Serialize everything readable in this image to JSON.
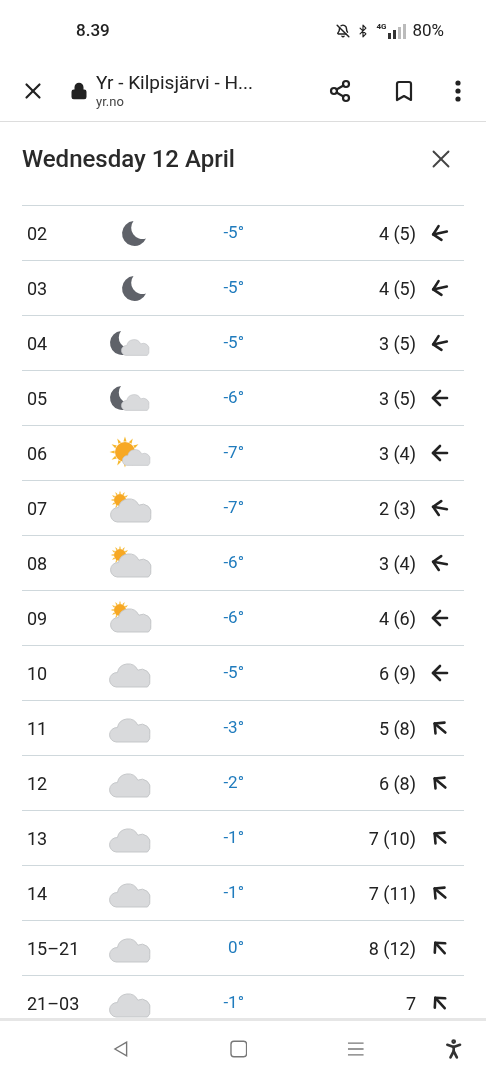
{
  "status_bar": {
    "time": "8.39",
    "network": "4G",
    "battery": "80%"
  },
  "browser_bar": {
    "title": "Yr - Kilpisjärvi - H...",
    "url": "yr.no"
  },
  "panel": {
    "title": "Wednesday 12 April"
  },
  "rows": [
    {
      "time": "02",
      "weather": {
        "kind": "moon"
      },
      "temperature": "-5°",
      "wind": "4 (5)",
      "wind_arrow": {
        "kind": "wsw"
      }
    },
    {
      "time": "03",
      "weather": {
        "kind": "moon"
      },
      "temperature": "-5°",
      "wind": "4 (5)",
      "wind_arrow": {
        "kind": "wsw"
      }
    },
    {
      "time": "04",
      "weather": {
        "kind": "moon_cloud"
      },
      "temperature": "-5°",
      "wind": "3 (5)",
      "wind_arrow": {
        "kind": "wsw"
      }
    },
    {
      "time": "05",
      "weather": {
        "kind": "moon_cloud"
      },
      "temperature": "-6°",
      "wind": "3 (5)",
      "wind_arrow": {
        "kind": "w"
      }
    },
    {
      "time": "06",
      "weather": {
        "kind": "sun_cloud"
      },
      "temperature": "-7°",
      "wind": "3 (4)",
      "wind_arrow": {
        "kind": "w"
      }
    },
    {
      "time": "07",
      "weather": {
        "kind": "cloud_sun"
      },
      "temperature": "-7°",
      "wind": "2 (3)",
      "wind_arrow": {
        "kind": "wnw"
      }
    },
    {
      "time": "08",
      "weather": {
        "kind": "cloud_sun"
      },
      "temperature": "-6°",
      "wind": "3 (4)",
      "wind_arrow": {
        "kind": "wnw"
      }
    },
    {
      "time": "09",
      "weather": {
        "kind": "cloud_sun"
      },
      "temperature": "-6°",
      "wind": "4 (6)",
      "wind_arrow": {
        "kind": "w"
      }
    },
    {
      "time": "10",
      "weather": {
        "kind": "cloud"
      },
      "temperature": "-5°",
      "wind": "6 (9)",
      "wind_arrow": {
        "kind": "w"
      }
    },
    {
      "time": "11",
      "weather": {
        "kind": "cloud"
      },
      "temperature": "-3°",
      "wind": "5 (8)",
      "wind_arrow": {
        "kind": "nw"
      }
    },
    {
      "time": "12",
      "weather": {
        "kind": "cloud"
      },
      "temperature": "-2°",
      "wind": "6 (8)",
      "wind_arrow": {
        "kind": "nw"
      }
    },
    {
      "time": "13",
      "weather": {
        "kind": "cloud"
      },
      "temperature": "-1°",
      "wind": "7 (10)",
      "wind_arrow": {
        "kind": "nw"
      }
    },
    {
      "time": "14",
      "weather": {
        "kind": "cloud"
      },
      "temperature": "-1°",
      "wind": "7 (11)",
      "wind_arrow": {
        "kind": "nw"
      }
    },
    {
      "time": "15–21",
      "weather": {
        "kind": "cloud"
      },
      "temperature": "0°",
      "wind": "8 (12)",
      "wind_arrow": {
        "kind": "nnw"
      }
    },
    {
      "time": "21–03",
      "weather": {
        "kind": "cloud"
      },
      "temperature": "-1°",
      "wind": "7",
      "wind_arrow": {
        "kind": "nnw"
      }
    }
  ]
}
